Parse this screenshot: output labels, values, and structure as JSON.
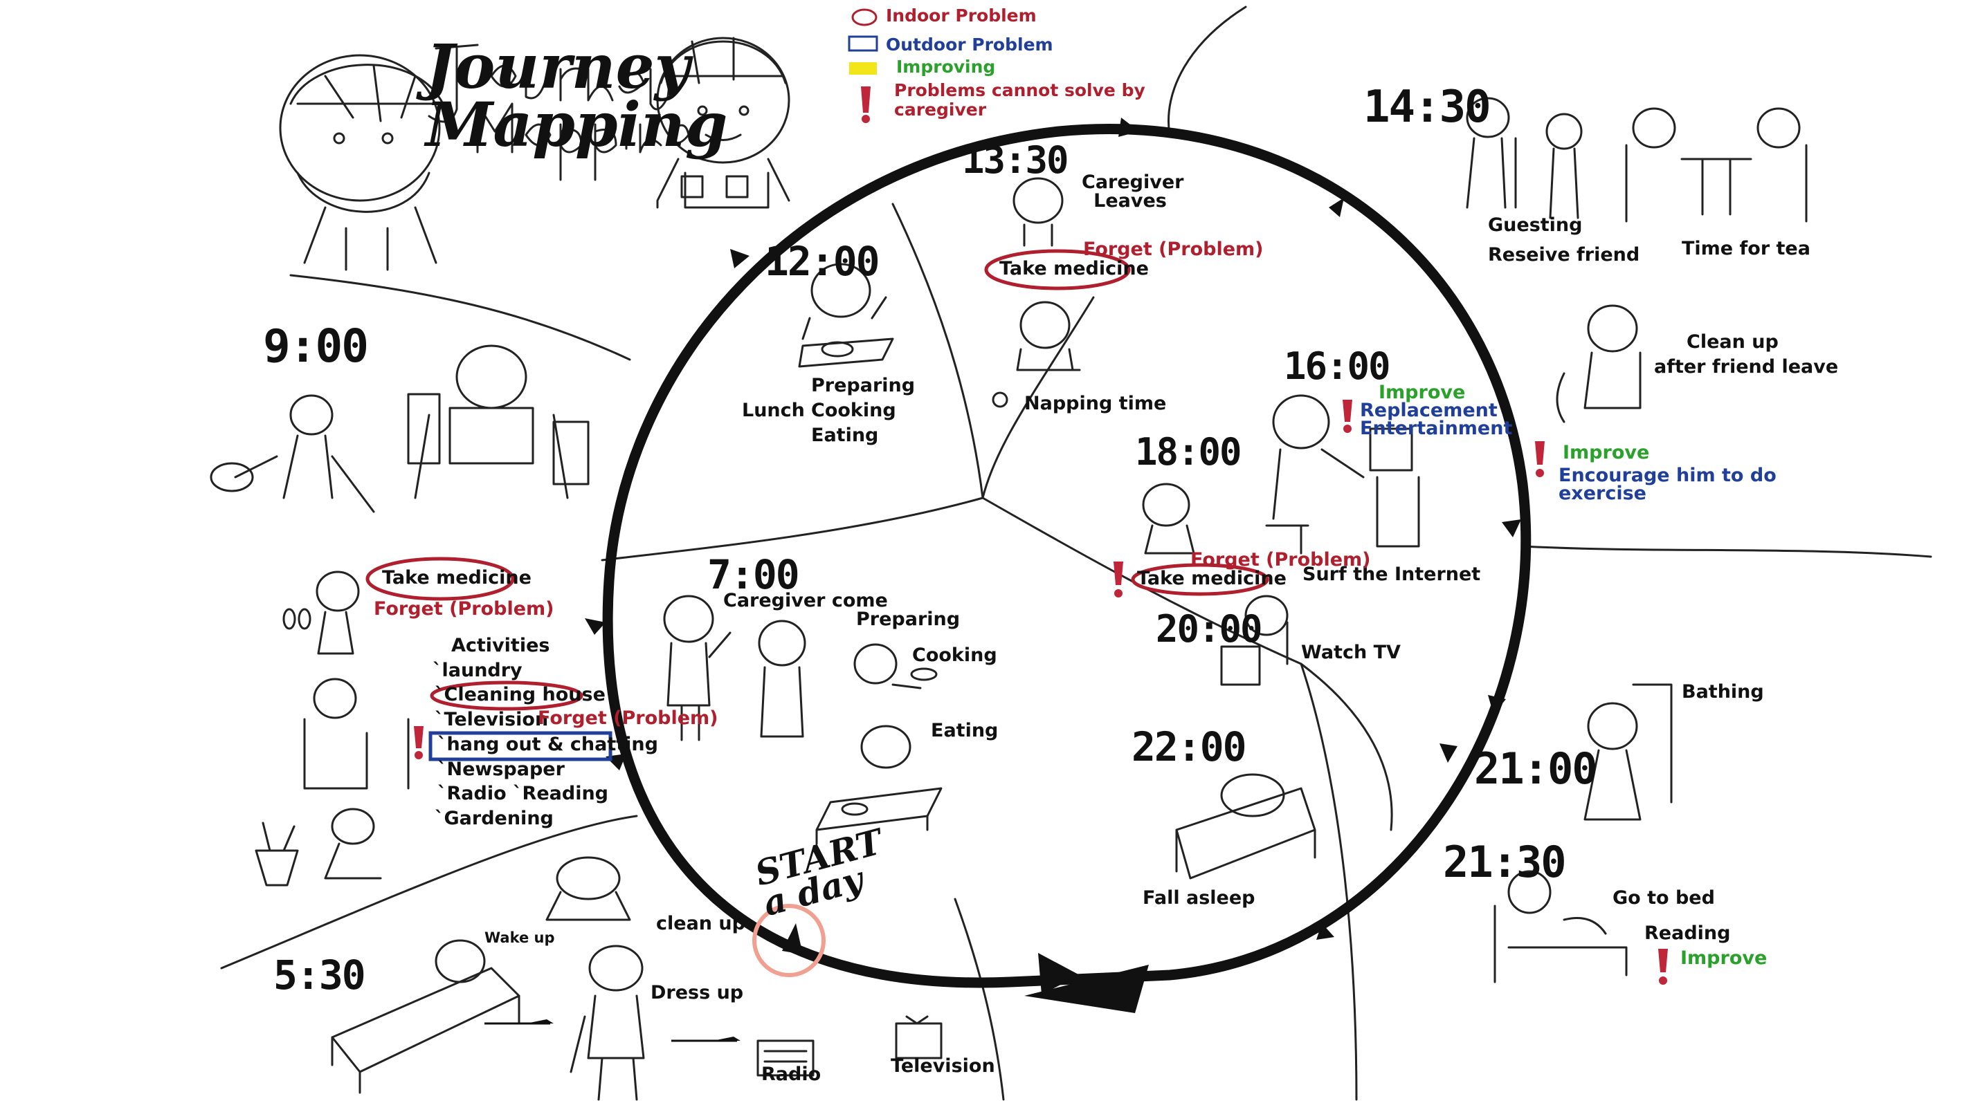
{
  "title": "Journey Mapping",
  "legend": {
    "items": [
      {
        "label": "Indoor Problem",
        "color": "#b01f2e"
      },
      {
        "label": "Outdoor Problem",
        "color": "#1f3f9a"
      },
      {
        "label": "Improving",
        "color": "#2aa12a"
      },
      {
        "label": "Problems cannot solve by caregiver",
        "color": "#b01f2e"
      }
    ]
  },
  "start_label": "START a day",
  "times": {
    "t530": "5:30",
    "t700": "7:00",
    "t900": "9:00",
    "t1200": "12:00",
    "t1330": "13:30",
    "t1430": "14:30",
    "t1600": "16:00",
    "t1800": "18:00",
    "t2000": "20:00",
    "t2100": "21:00",
    "t2130": "21:30",
    "t2200": "22:00"
  },
  "labels": {
    "wake_up": "Wake up",
    "clean_up": "clean up",
    "dress_up": "Dress up",
    "radio": "Radio",
    "television": "Television",
    "caregiver_come": "Caregiver come",
    "preparing_morning": "Preparing",
    "cooking_morning": "Cooking",
    "eating_morning": "Eating",
    "take_medicine_left": "Take medicine",
    "forget_left": "Forget (Problem)",
    "activities": "Activities",
    "laundry": "`laundry",
    "cleaning_house": "`Cleaning house",
    "television_activity": "`Television",
    "forget_activity": "Forget (Problem)",
    "hang_out": "`hang out & chatting",
    "newspaper": "`Newspaper",
    "radio_reading": "`Radio `Reading",
    "gardening": "`Gardening",
    "lunch": "Lunch",
    "preparing_lunch": "Preparing",
    "cooking_lunch": "Cooking",
    "eating_lunch": "Eating",
    "caregiver_leaves": "Caregiver Leaves",
    "forget_1330": "Forget (Problem)",
    "take_medicine_1330": "Take medicine",
    "napping_time": "Napping time",
    "guesting": "Guesting",
    "receive_friend": "Reseive friend",
    "time_for_tea": "Time for tea",
    "clean_up_after": "Clean up",
    "after_friend_leave": "after friend leave",
    "improve_1": "Improve",
    "encourage": "Encourage him to do",
    "exercise": "exercise",
    "improve_2": "Improve",
    "replacement": "Replacement",
    "entertainment": "Entertainment",
    "surf": "Surf the Internet",
    "forget_1800": "Forget (Problem)",
    "take_medicine_1800": "Take medicine",
    "watch_tv": "Watch TV",
    "bathing": "Bathing",
    "fall_asleep": "Fall asleep",
    "go_to_bed": "Go to bed",
    "reading": "Reading",
    "improve_3": "Improve"
  }
}
